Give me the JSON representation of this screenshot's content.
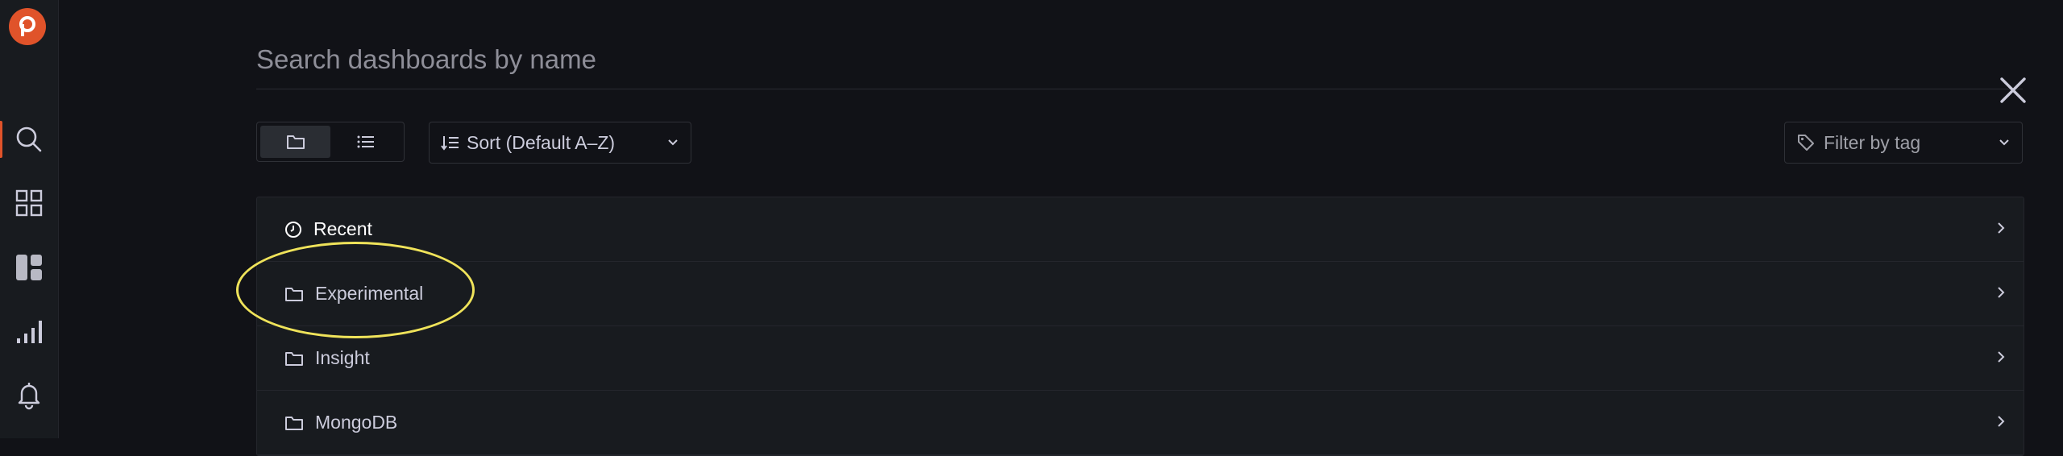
{
  "sidebar": {
    "items": [
      {
        "name": "search-icon",
        "active": true
      },
      {
        "name": "dashboards-grid-icon",
        "active": false
      },
      {
        "name": "panels-icon",
        "active": false
      },
      {
        "name": "explore-bars-icon",
        "active": false
      },
      {
        "name": "alerting-bell-icon",
        "active": false
      }
    ]
  },
  "search": {
    "placeholder": "Search dashboards by name",
    "value": ""
  },
  "toolbar": {
    "view_modes": [
      "folder-view",
      "list-view"
    ],
    "sort_label": "Sort (Default A–Z)",
    "tag_filter_label": "Filter by tag"
  },
  "folders": [
    {
      "label": "Recent",
      "icon": "clock-icon"
    },
    {
      "label": "Experimental",
      "icon": "folder-icon"
    },
    {
      "label": "Insight",
      "icon": "folder-icon"
    },
    {
      "label": "MongoDB",
      "icon": "folder-icon"
    }
  ],
  "colors": {
    "accent": "#e0532a",
    "highlight": "#efe35a",
    "background": "#111217"
  }
}
